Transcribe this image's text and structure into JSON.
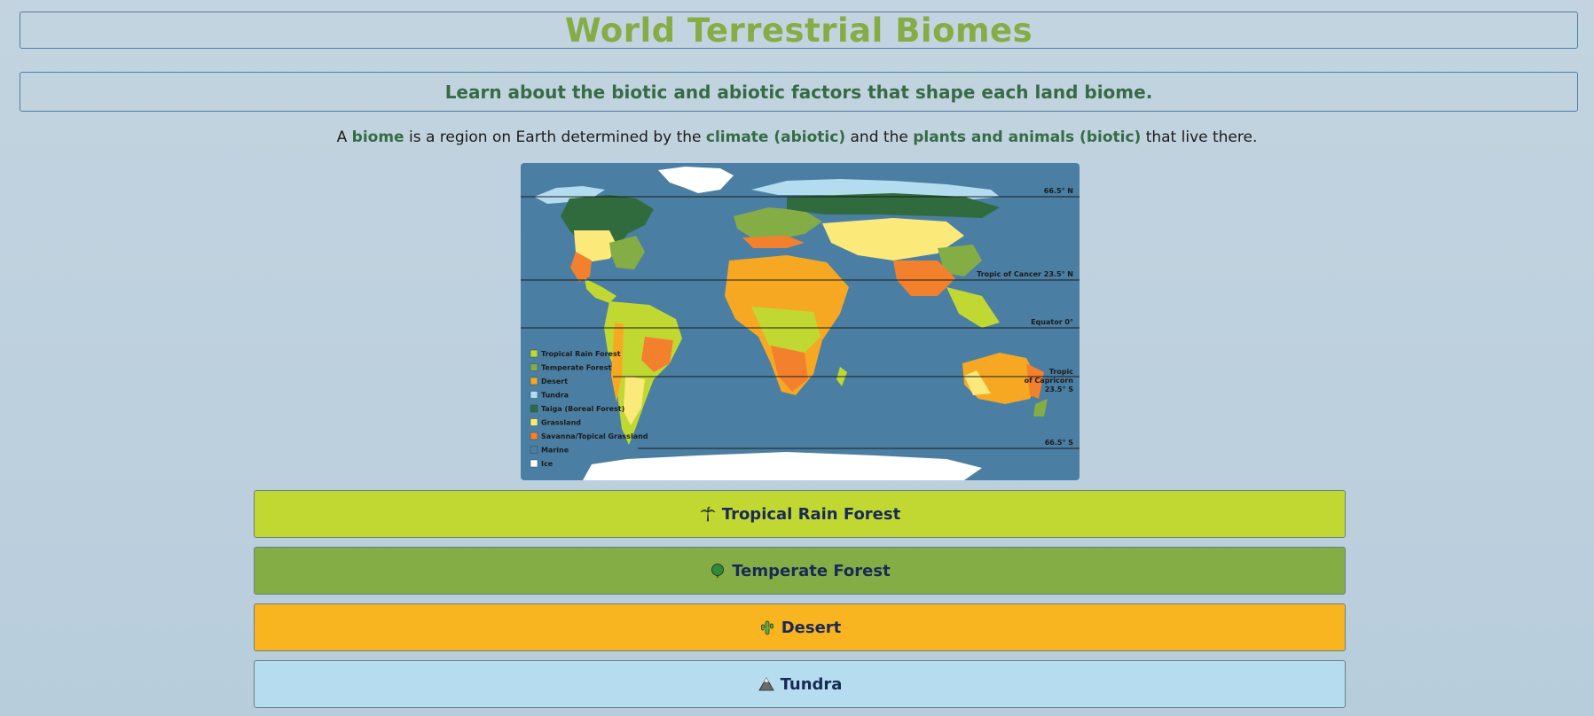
{
  "header": {
    "title": "World Terrestrial Biomes",
    "subtitle": "Learn about the biotic and abiotic factors that shape each land biome."
  },
  "intro": {
    "part1": "A ",
    "term_biome": "biome",
    "part2": " is a region on Earth determined by the ",
    "term_climate": "climate (abiotic)",
    "part3": " and the ",
    "term_life": "plants and animals (biotic)",
    "part4": " that live there."
  },
  "map": {
    "lines": {
      "arctic": "66.5° N",
      "cancer": "Tropic of Cancer 23.5° N",
      "equator": "Equator 0°",
      "capricorn_1": "Tropic",
      "capricorn_2": "of Capricorn",
      "capricorn_3": "23.5° S",
      "antarctic": "66.5° S"
    },
    "legend": [
      {
        "label": "Tropical Rain Forest",
        "color": "#c1d832"
      },
      {
        "label": "Temperate Forest",
        "color": "#84ad45"
      },
      {
        "label": "Desert",
        "color": "#f7a823"
      },
      {
        "label": "Tundra",
        "color": "#b3dcef"
      },
      {
        "label": "Taiga (Boreal Forest)",
        "color": "#2f6b3d"
      },
      {
        "label": "Grassland",
        "color": "#fbe97a"
      },
      {
        "label": "Savanna/Topical Grassland",
        "color": "#f3802d"
      },
      {
        "label": "Marine",
        "color": "#4a7fa3"
      },
      {
        "label": "Ice",
        "color": "#ffffff"
      }
    ]
  },
  "biomes": [
    {
      "label": "Tropical Rain Forest",
      "icon": "palm-tree-icon",
      "color": "#c1d832"
    },
    {
      "label": "Temperate Forest",
      "icon": "deciduous-tree-icon",
      "color": "#84ad45"
    },
    {
      "label": "Desert",
      "icon": "cactus-icon",
      "color": "#f9b520"
    },
    {
      "label": "Tundra",
      "icon": "mountain-icon",
      "color": "#b6ddef"
    }
  ],
  "colors": {
    "title": "#84ad45",
    "subtitle": "#356b45",
    "border": "#4f7ea6"
  }
}
